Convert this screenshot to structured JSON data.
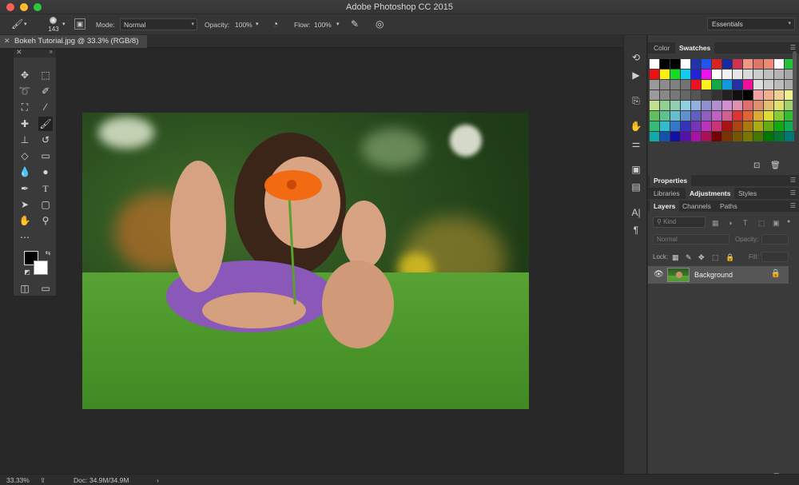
{
  "window": {
    "title": "Adobe Photoshop CC 2015"
  },
  "options_bar": {
    "brush_size": "143",
    "mode_label": "Mode:",
    "mode_value": "Normal",
    "opacity_label": "Opacity:",
    "opacity_value": "100%",
    "flow_label": "Flow:",
    "flow_value": "100%",
    "workspace": "Essentials"
  },
  "document": {
    "tab_title": "Bokeh Tutorial.jpg @ 33.3% (RGB/8)"
  },
  "panels": {
    "top_tabs": [
      "Color",
      "Swatches"
    ],
    "properties_tab": "Properties",
    "mid_tabs": [
      "Libraries",
      "Adjustments",
      "Styles"
    ],
    "layer_tabs": [
      "Layers",
      "Channels",
      "Paths"
    ],
    "kind_placeholder": "Kind",
    "blend_mode": "Normal",
    "opacity_label": "Opacity:",
    "lock_label": "Lock:",
    "fill_label": "Fill:",
    "layer_name": "Background"
  },
  "swatches": [
    "#ffffff",
    "#000000",
    "#000000",
    "#ffffff",
    "#2233aa",
    "#2255ee",
    "#dd2222",
    "#1a2a9a",
    "#cc3355",
    "#ee9988",
    "#dd7766",
    "#ee8877",
    "#ffffff",
    "#23c23a",
    "#ee1111",
    "#ffee11",
    "#11dd22",
    "#11ccee",
    "#2222dd",
    "#ee11ee",
    "#ffffff",
    "#f2f2f2",
    "#e6e6e6",
    "#d9d9d9",
    "#cccccc",
    "#bfbfbf",
    "#b3b3b3",
    "#a6a6a6",
    "#999999",
    "#8c8c8c",
    "#808080",
    "#737373",
    "#ee1122",
    "#ffee22",
    "#11aa44",
    "#1199dd",
    "#2233aa",
    "#ee1199",
    "#dddddd",
    "#cccccc",
    "#bbbbbb",
    "#aaaaaa",
    "#9a9a9a",
    "#888888",
    "#777777",
    "#666666",
    "#555555",
    "#444444",
    "#333333",
    "#222222",
    "#111111",
    "#000000",
    "#f0a0a0",
    "#f0b090",
    "#f0d090",
    "#f0f090",
    "#c0e090",
    "#90d090",
    "#90d0b0",
    "#90d0e0",
    "#90b0e0",
    "#9090d0",
    "#b090d0",
    "#d090d0",
    "#e090b0",
    "#e07070",
    "#e09070",
    "#e0c070",
    "#e0e070",
    "#a0d070",
    "#60c060",
    "#60c090",
    "#60c0d0",
    "#6090d0",
    "#6060c0",
    "#9060c0",
    "#c060c0",
    "#d06090",
    "#dd3333",
    "#dd6633",
    "#ddaa33",
    "#dddd33",
    "#88cc33",
    "#33bb33",
    "#33bb77",
    "#33bbcc",
    "#3377cc",
    "#3333bb",
    "#7733bb",
    "#bb33bb",
    "#cc3377",
    "#aa1111",
    "#aa4411",
    "#aa7711",
    "#aaaa11",
    "#66aa11",
    "#11aa11",
    "#11aa55",
    "#11aaaa",
    "#1155aa",
    "#1111aa",
    "#5511aa",
    "#aa11aa",
    "#aa1155",
    "#770000",
    "#773300",
    "#775500",
    "#777700",
    "#447700",
    "#007700",
    "#007733",
    "#007777"
  ],
  "status": {
    "zoom": "33.33%",
    "doc": "Doc: 34.9M/34.9M"
  }
}
